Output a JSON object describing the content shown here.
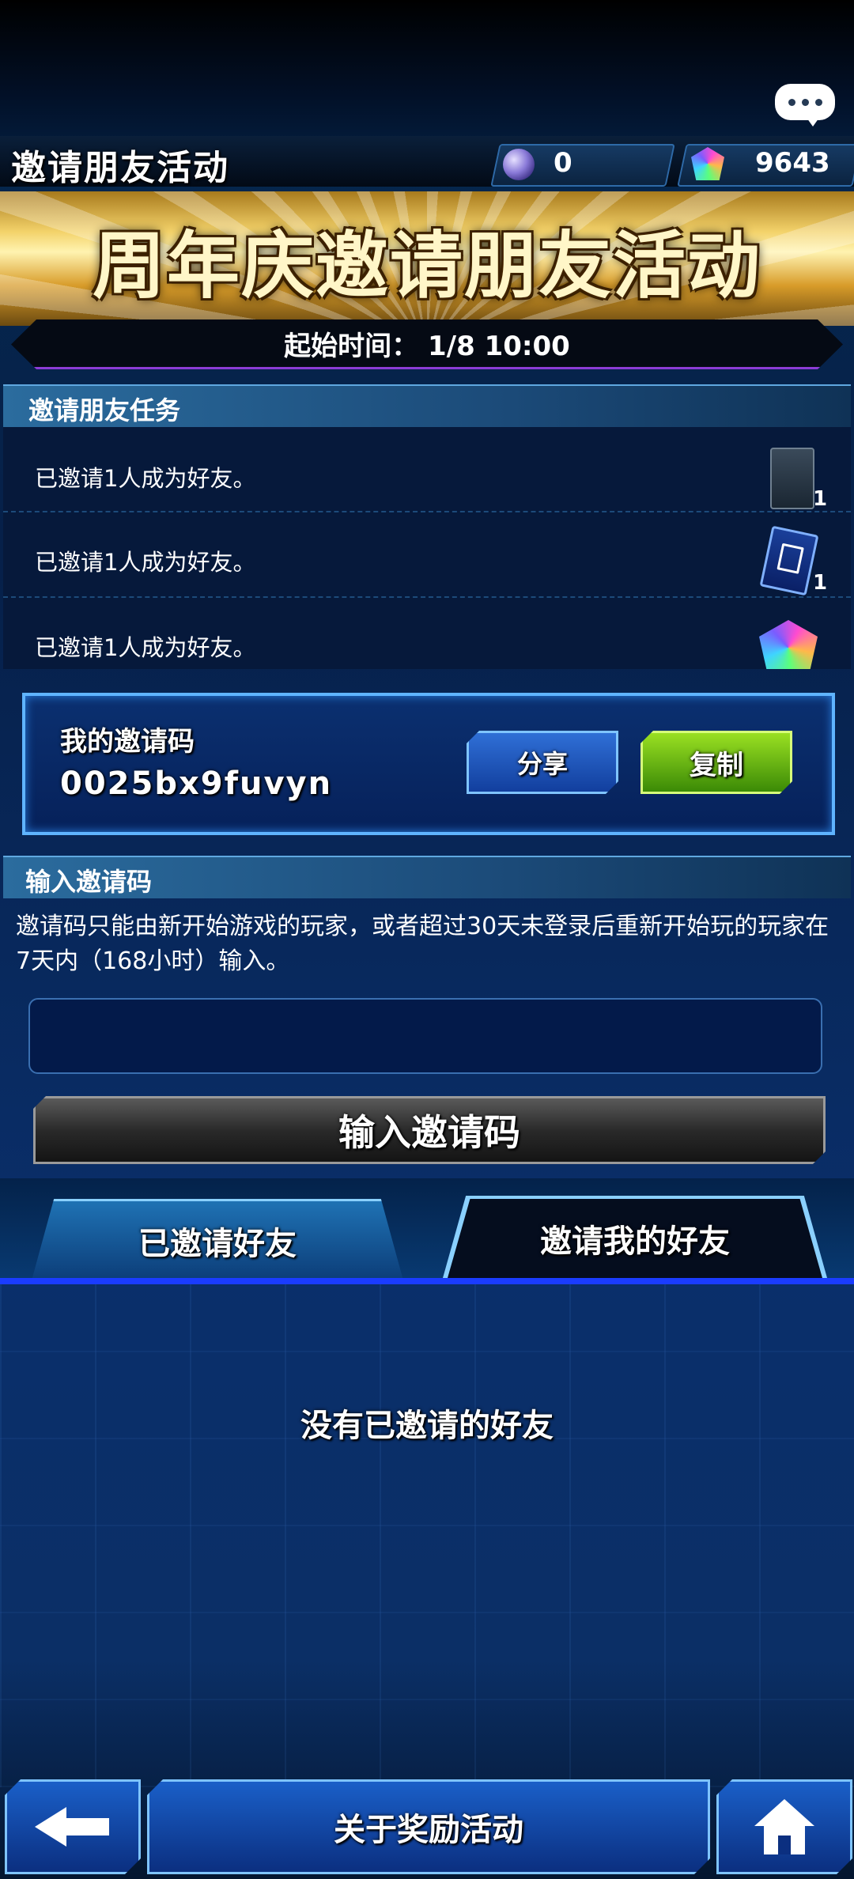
{
  "header": {
    "title": "邀请朋友活动",
    "orb_count": "0",
    "gem_count": "9643"
  },
  "banner": {
    "title": "周年庆邀请朋友活动",
    "start_time": "起始时间： 1/8 10:00"
  },
  "tasks_section": {
    "label": "邀请朋友任务",
    "items": [
      {
        "text": "已邀请1人成为好友。",
        "reward_icon": "card-pack-icon",
        "reward_count": "1"
      },
      {
        "text": "已邀请1人成为好友。",
        "reward_icon": "card-ticket-icon",
        "reward_count": "1"
      },
      {
        "text": "已邀请1人成为好友。",
        "reward_icon": "gem-icon",
        "reward_count": ""
      }
    ]
  },
  "my_code": {
    "label": "我的邀请码",
    "value": "0025bx9fuvyn",
    "share_label": "分享",
    "copy_label": "复制"
  },
  "enter_code": {
    "label": "输入邀请码",
    "description": "邀请码只能由新开始游戏的玩家，或者超过30天未登录后重新开始玩的玩家在7天内（168小时）输入。",
    "input_value": "",
    "button_label": "输入邀请码"
  },
  "tabs": {
    "invited": "已邀请好友",
    "invited_me": "邀请我的好友"
  },
  "empty_message": "没有已邀请的好友",
  "bottom_nav": {
    "about_label": "关于奖励活动"
  },
  "colors": {
    "accent_blue": "#1a5fc8",
    "copy_green": "#6cc014",
    "tab_line": "#1a3cff"
  }
}
